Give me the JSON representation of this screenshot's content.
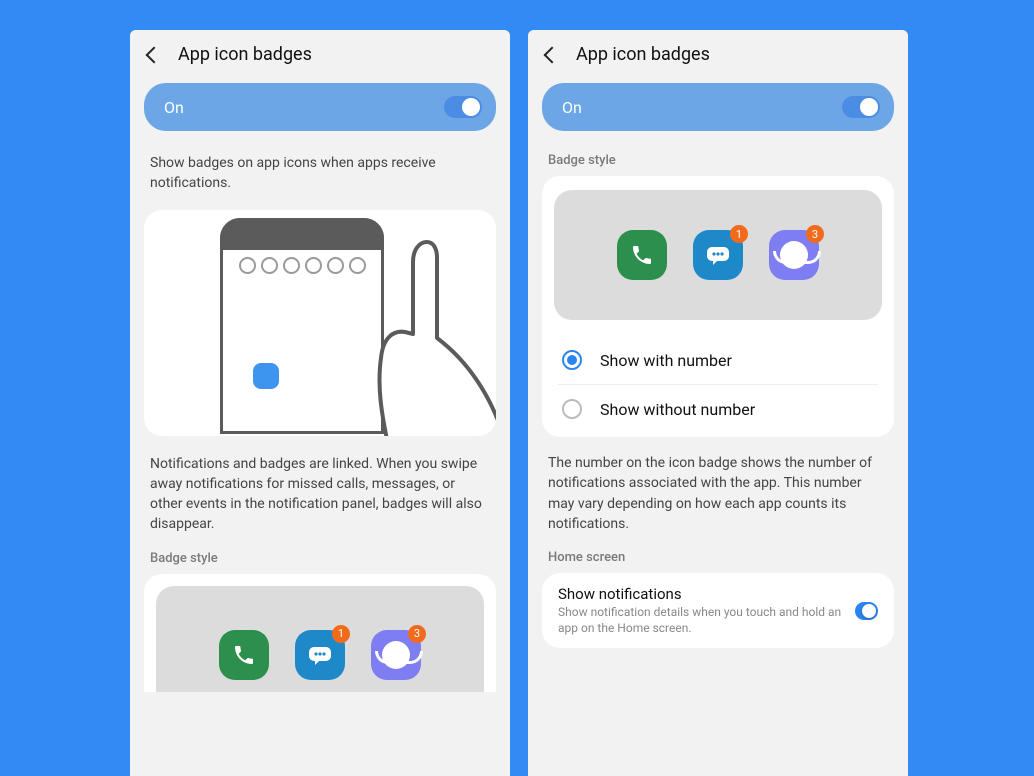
{
  "left": {
    "title": "App icon badges",
    "toggle_label": "On",
    "desc1": "Show badges on app icons when apps receive notifications.",
    "desc2": "Notifications and badges are linked. When you swipe away notifications for missed calls, messages, or other events in the notification panel, badges will also disappear.",
    "section_badge_style": "Badge style",
    "badges": {
      "msg": "1",
      "browser": "3"
    }
  },
  "right": {
    "title": "App icon badges",
    "toggle_label": "On",
    "section_badge_style": "Badge style",
    "badges": {
      "msg": "1",
      "browser": "3"
    },
    "radio": {
      "with": "Show with number",
      "without": "Show without number"
    },
    "desc": "The number on the icon badge shows the number of notifications associated with the app. This number may vary depending on how each app counts its notifications.",
    "section_home": "Home screen",
    "home": {
      "title": "Show notifications",
      "sub": "Show notification details when you touch and hold an app on the Home screen."
    }
  }
}
